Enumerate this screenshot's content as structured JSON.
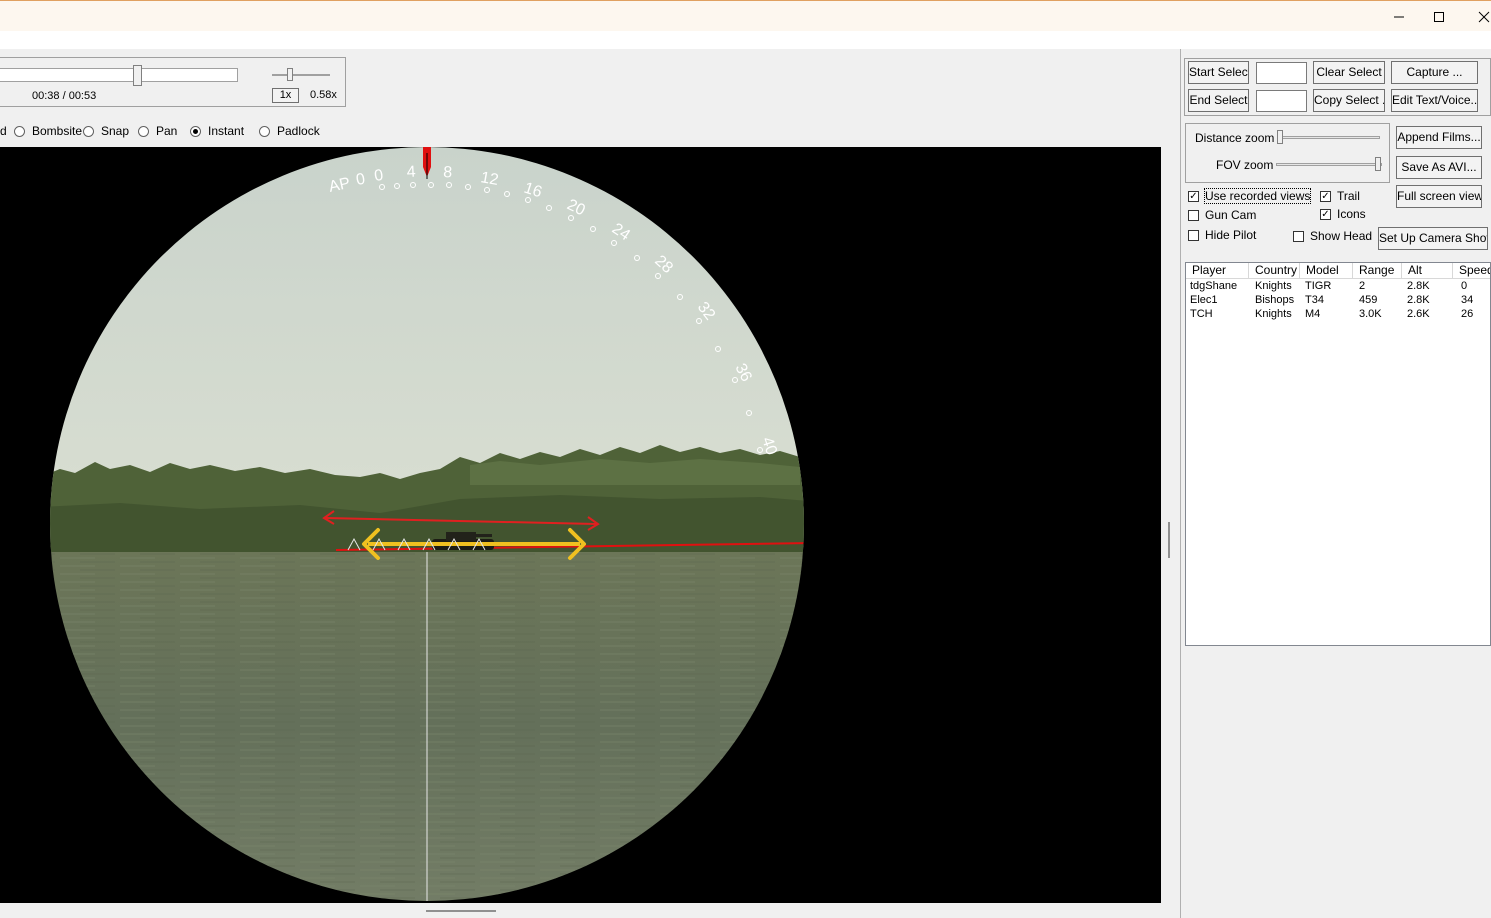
{
  "playback": {
    "time": "00:38 / 00:53",
    "rate_button": "1x",
    "speed": "0.58x"
  },
  "view_modes": [
    {
      "label": "d",
      "selected": false
    },
    {
      "label": "Bombsite",
      "selected": false
    },
    {
      "label": "Snap",
      "selected": false
    },
    {
      "label": "Pan",
      "selected": false
    },
    {
      "label": "Instant",
      "selected": true
    },
    {
      "label": "Padlock",
      "selected": false
    }
  ],
  "gunsight": {
    "prefix": "AP",
    "scale": [
      "0",
      "0",
      "4",
      "8",
      "12",
      "16",
      "20",
      "24",
      "28",
      "32",
      "36",
      "40"
    ]
  },
  "right_panel": {
    "start_select": "Start Select",
    "end_select": "End Select",
    "clear_select": "Clear Select",
    "copy_select": "Copy Select ...",
    "capture": "Capture ...",
    "edit_text_voice": "Edit Text/Voice...",
    "distance_zoom": "Distance zoom",
    "fov_zoom": "FOV zoom",
    "append_films": "Append Films...",
    "save_as_avi": "Save As AVI...",
    "full_screen_view": "Full screen view",
    "set_up_camera_shots": "Set Up Camera Shots",
    "use_recorded_views": {
      "label": "Use recorded views",
      "checked": true
    },
    "trail": {
      "label": "Trail",
      "checked": true
    },
    "gun_cam": {
      "label": "Gun Cam",
      "checked": false
    },
    "icons": {
      "label": "Icons",
      "checked": true
    },
    "hide_pilot": {
      "label": "Hide Pilot",
      "checked": false
    },
    "show_head": {
      "label": "Show Head",
      "checked": false
    }
  },
  "player_table": {
    "columns": [
      "Player",
      "Country",
      "Model",
      "Range",
      "Alt",
      "Speed"
    ],
    "rows": [
      [
        "tdgShane",
        "Knights",
        "TIGR",
        "2",
        "2.8K",
        "0"
      ],
      [
        "Elec1",
        "Bishops",
        "T34",
        "459",
        "2.8K",
        "34"
      ],
      [
        "TCH",
        "Knights",
        "M4",
        "3.0K",
        "2.6K",
        "26"
      ]
    ]
  }
}
